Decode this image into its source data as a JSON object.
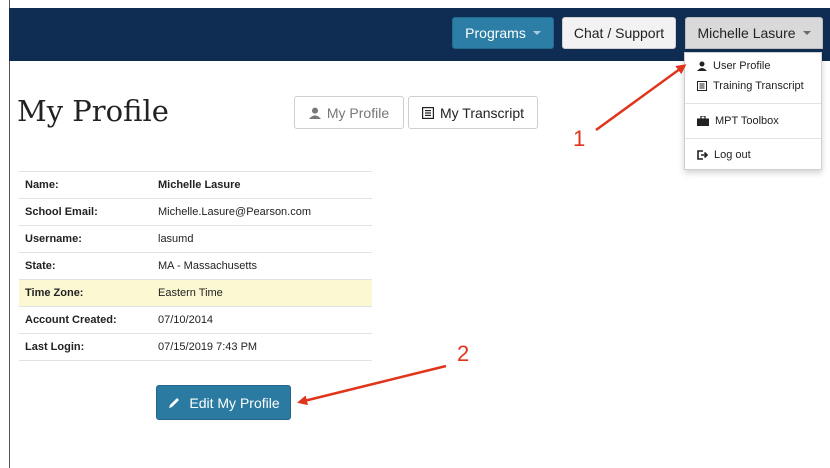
{
  "topbar": {
    "programs_label": "Programs",
    "chat_label": "Chat / Support",
    "user_label": "Michelle Lasure"
  },
  "user_menu": {
    "items": [
      {
        "label": "User Profile",
        "icon": "user-icon"
      },
      {
        "label": "Training Transcript",
        "icon": "transcript-icon"
      },
      {
        "label": "MPT Toolbox",
        "icon": "briefcase-icon"
      },
      {
        "label": "Log out",
        "icon": "logout-icon"
      }
    ]
  },
  "page": {
    "title": "My Profile",
    "tabs": [
      {
        "label": "My Profile",
        "icon": "user-icon"
      },
      {
        "label": "My Transcript",
        "icon": "transcript-icon"
      }
    ]
  },
  "profile": {
    "rows": [
      {
        "label": "Name:",
        "value": "Michelle Lasure"
      },
      {
        "label": "School Email:",
        "value": "Michelle.Lasure@Pearson.com"
      },
      {
        "label": "Username:",
        "value": "lasumd"
      },
      {
        "label": "State:",
        "value": "MA - Massachusetts"
      },
      {
        "label": "Time Zone:",
        "value": "Eastern Time"
      },
      {
        "label": "Account Created:",
        "value": "07/10/2014"
      },
      {
        "label": "Last Login:",
        "value": "07/15/2019 7:43 PM"
      }
    ],
    "edit_label": "Edit My Profile"
  },
  "annotations": {
    "callout_1": "1",
    "callout_2": "2"
  },
  "colors": {
    "topbar": "#0f2d52",
    "primary_button": "#2b7aa1",
    "highlight_row": "#fcf8d2",
    "annotation": "#e0341b"
  }
}
